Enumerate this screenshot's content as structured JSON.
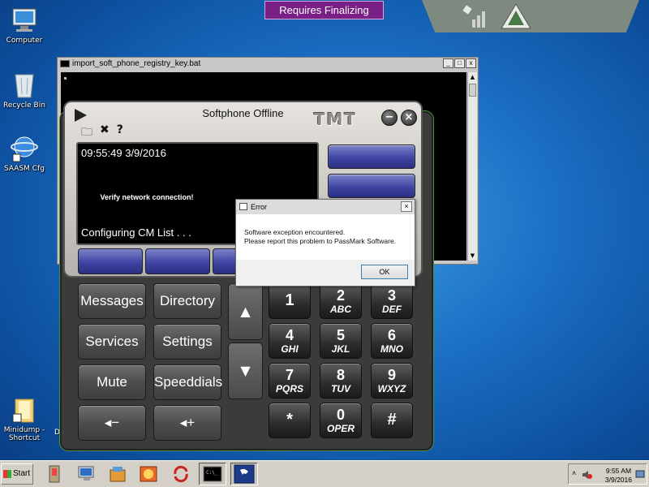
{
  "desktop": {
    "icons": [
      {
        "label": "Computer",
        "icon": "computer-icon"
      },
      {
        "label": "Recycle Bin",
        "icon": "recycle-bin-icon"
      },
      {
        "label": "SAASM Cfg",
        "icon": "saasm-cfg-icon"
      },
      {
        "label": "Minidump - Shortcut",
        "icon": "folder-shortcut-icon"
      }
    ],
    "banner": "Requires Finalizing"
  },
  "cmd_window": {
    "title": "import_soft_phone_registry_key.bat",
    "controls": [
      "_",
      "□",
      "x"
    ]
  },
  "softphone": {
    "title": "Softphone Offline",
    "brand": "TMT",
    "toolbar": [
      "folder-icon",
      "tools-icon",
      "help-icon"
    ],
    "datetime": "09:55:49   3/9/2016",
    "status_message": "Verify network connection!",
    "config_message": "Configuring CM List . . .",
    "function_buttons": {
      "messages": "Messages",
      "directory": "Directory",
      "services": "Services",
      "settings": "Settings",
      "mute": "Mute",
      "speeddials": "Speeddials",
      "volume_down": "◂−",
      "volume_up": "◂+"
    },
    "scroll_up": "▲",
    "scroll_down": "▼",
    "keypad": [
      {
        "num": "1",
        "letters": ""
      },
      {
        "num": "2",
        "letters": "ABC"
      },
      {
        "num": "3",
        "letters": "DEF"
      },
      {
        "num": "4",
        "letters": "GHI"
      },
      {
        "num": "5",
        "letters": "JKL"
      },
      {
        "num": "6",
        "letters": "MNO"
      },
      {
        "num": "7",
        "letters": "PQRS"
      },
      {
        "num": "8",
        "letters": "TUV"
      },
      {
        "num": "9",
        "letters": "WXYZ"
      },
      {
        "num": "*",
        "letters": ""
      },
      {
        "num": "0",
        "letters": "OPER"
      },
      {
        "num": "#",
        "letters": ""
      }
    ]
  },
  "error_dialog": {
    "title": "Error",
    "line1": "Software exception encountered.",
    "line2": "Please report this problem to PassMark Software.",
    "ok_label": "OK"
  },
  "taskbar": {
    "start_label": "Start",
    "apps": [
      "app-icon-1",
      "app-icon-2",
      "app-icon-3",
      "app-icon-4",
      "app-icon-5",
      "cmd-icon",
      "softphone-icon"
    ],
    "clock_time": "9:55 AM",
    "clock_date": "3/9/2016"
  },
  "colors": {
    "banner_bg": "#7a1f86",
    "softphone_blue": "#3f45a2",
    "desktop_blue": "#1b6fc4"
  }
}
